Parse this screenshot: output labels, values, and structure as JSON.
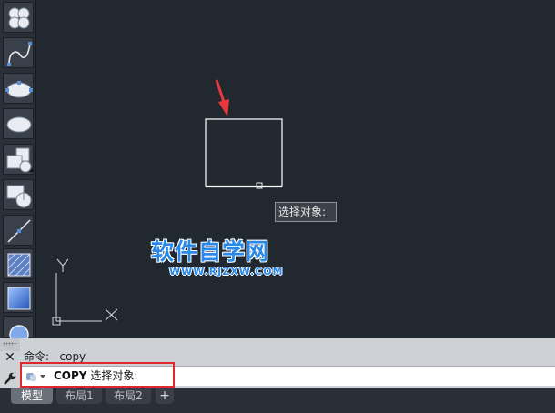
{
  "canvas": {
    "tooltip": "选择对象:",
    "ucs_labels": {
      "y": "Y",
      "x": "X"
    }
  },
  "watermark": {
    "main": "软件自学网",
    "sub": "WWW.RJZXW.COM"
  },
  "toolbar": {
    "tools": [
      "revision-cloud-icon",
      "spline-icon",
      "ellipse-icon",
      "ellipse-arc-icon",
      "insert-block-icon",
      "make-block-icon",
      "construction-line-icon",
      "hatch-icon",
      "gradient-icon",
      "region-icon"
    ]
  },
  "command": {
    "history_label": "命令:",
    "history_value": "copy",
    "prompt_command": "COPY",
    "prompt_text": "选择对象:"
  },
  "tabs": {
    "items": [
      {
        "label": "模型",
        "active": true
      },
      {
        "label": "布局1",
        "active": false
      },
      {
        "label": "布局2",
        "active": false
      }
    ],
    "add_label": "+"
  },
  "colors": {
    "background": "#212830",
    "highlight": "#e0282c",
    "arrow": "#e8383d",
    "watermark": "#2a88e8"
  }
}
